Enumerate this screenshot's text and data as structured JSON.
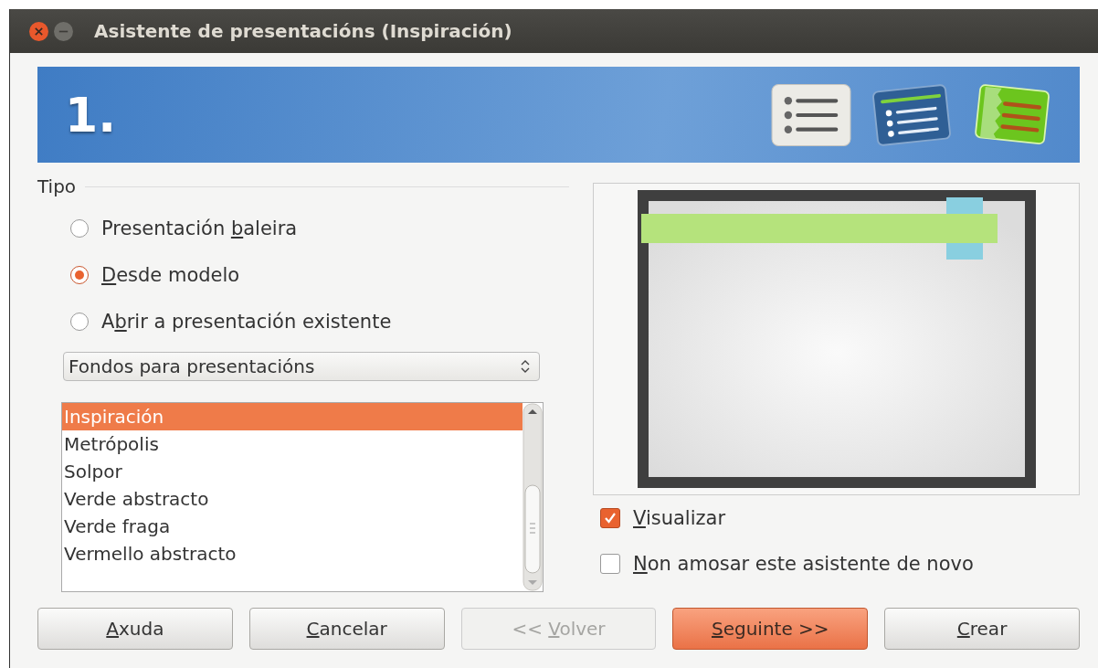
{
  "window": {
    "title": "Asistente de presentacións (Inspiración)"
  },
  "banner": {
    "step": "1."
  },
  "type_group": {
    "title": "Tipo",
    "options": [
      {
        "label": {
          "before": "Presentación ",
          "key": "b",
          "after": "aleira"
        },
        "selected": false
      },
      {
        "label": {
          "key": "D",
          "after": "esde modelo"
        },
        "selected": true
      },
      {
        "label": {
          "before": "A",
          "key": "b",
          "after": "rir a presentación existente"
        },
        "selected": false
      }
    ],
    "category": {
      "value": "Fondos para presentacións"
    },
    "templates": [
      {
        "label": "Inspiración",
        "selected": true
      },
      {
        "label": "Metrópolis",
        "selected": false
      },
      {
        "label": "Solpor",
        "selected": false
      },
      {
        "label": "Verde abstracto",
        "selected": false
      },
      {
        "label": "Verde fraga",
        "selected": false
      },
      {
        "label": "Vermello abstracto",
        "selected": false
      }
    ]
  },
  "checkboxes": [
    {
      "label": {
        "key": "V",
        "after": "isualizar"
      },
      "checked": true
    },
    {
      "label": {
        "key": "N",
        "after": "on amosar este asistente de novo"
      },
      "checked": false
    }
  ],
  "buttons": [
    {
      "label": {
        "key": "A",
        "after": "xuda"
      },
      "kind": "normal"
    },
    {
      "label": {
        "key": "C",
        "after": "ancelar"
      },
      "kind": "normal"
    },
    {
      "label": {
        "before": "<< ",
        "key": "V",
        "after": "olver"
      },
      "kind": "disabled"
    },
    {
      "label": {
        "key": "S",
        "after": "eguinte >>"
      },
      "kind": "default"
    },
    {
      "label": {
        "key": "C",
        "after": "rear"
      },
      "kind": "normal"
    }
  ]
}
